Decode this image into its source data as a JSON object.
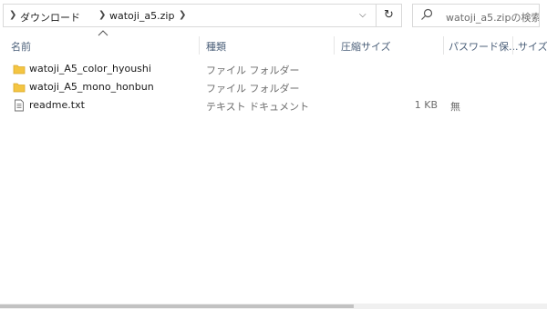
{
  "address_bar": {
    "breadcrumbs": [
      "ダウンロード",
      "watoji_a5.zip"
    ]
  },
  "search": {
    "placeholder": "watoji_a5.zipの検索"
  },
  "columns": {
    "name": "名前",
    "type": "種類",
    "compressed_size": "圧縮サイズ",
    "password": "パスワード保...",
    "size": "サイズ"
  },
  "files": [
    {
      "name": "watoji_A5_color_hyoushi",
      "type": "ファイル フォルダー",
      "compressed_size": "",
      "password": "",
      "icon": "folder-icon"
    },
    {
      "name": "watoji_A5_mono_honbun",
      "type": "ファイル フォルダー",
      "compressed_size": "",
      "password": "",
      "icon": "folder-icon"
    },
    {
      "name": "readme.txt",
      "type": "テキスト ドキュメント",
      "compressed_size": "1 KB",
      "password": "無",
      "icon": "text-file-icon"
    }
  ],
  "colors": {
    "folder": "#f4c542",
    "header_text": "#4c607a"
  }
}
